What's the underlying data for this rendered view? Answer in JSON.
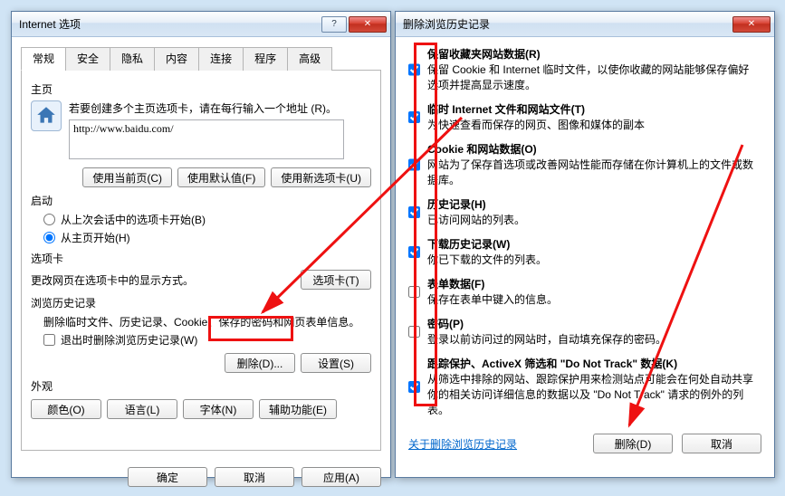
{
  "left": {
    "title": "Internet 选项",
    "tabs": [
      "常规",
      "安全",
      "隐私",
      "内容",
      "连接",
      "程序",
      "高级"
    ],
    "active_tab": 0,
    "home": {
      "label": "主页",
      "desc": "若要创建多个主页选项卡，请在每行输入一个地址 (R)。",
      "url_value": "http://www.baidu.com/",
      "btn_current": "使用当前页(C)",
      "btn_default": "使用默认值(F)",
      "btn_newtab": "使用新选项卡(U)"
    },
    "startup": {
      "label": "启动",
      "opt_last": "从上次会话中的选项卡开始(B)",
      "opt_home": "从主页开始(H)",
      "selected": "home"
    },
    "tabs_section": {
      "label": "选项卡",
      "desc": "更改网页在选项卡中的显示方式。",
      "btn": "选项卡(T)"
    },
    "history": {
      "label": "浏览历史记录",
      "desc": "删除临时文件、历史记录、Cookie、保存的密码和网页表单信息。",
      "chk_exit": "退出时删除浏览历史记录(W)",
      "btn_delete": "删除(D)...",
      "btn_settings": "设置(S)"
    },
    "appearance": {
      "label": "外观",
      "btn_color": "颜色(O)",
      "btn_lang": "语言(L)",
      "btn_font": "字体(N)",
      "btn_access": "辅助功能(E)"
    },
    "footer": {
      "ok": "确定",
      "cancel": "取消",
      "apply": "应用(A)"
    }
  },
  "right": {
    "title": "删除浏览历史记录",
    "items": [
      {
        "checked": true,
        "title": "保留收藏夹网站数据(R)",
        "desc": "保留 Cookie 和 Internet 临时文件，以使你收藏的网站能够保存偏好选项并提高显示速度。"
      },
      {
        "checked": true,
        "title": "临时 Internet 文件和网站文件(T)",
        "desc": "为快速查看而保存的网页、图像和媒体的副本"
      },
      {
        "checked": true,
        "title": "Cookie 和网站数据(O)",
        "desc": "网站为了保存首选项或改善网站性能而存储在你计算机上的文件或数据库。"
      },
      {
        "checked": true,
        "title": "历史记录(H)",
        "desc": "已访问网站的列表。"
      },
      {
        "checked": true,
        "title": "下载历史记录(W)",
        "desc": "你已下载的文件的列表。"
      },
      {
        "checked": false,
        "title": "表单数据(F)",
        "desc": "保存在表单中键入的信息。"
      },
      {
        "checked": false,
        "title": "密码(P)",
        "desc": "登录以前访问过的网站时，自动填充保存的密码。"
      },
      {
        "checked": true,
        "title": "跟踪保护、ActiveX 筛选和 \"Do Not Track\" 数据(K)",
        "desc": "从筛选中排除的网站、跟踪保护用来检测站点可能会在何处自动共享你的相关访问详细信息的数据以及 \"Do Not Track\" 请求的例外的列表。"
      }
    ],
    "link": "关于删除浏览历史记录",
    "btn_delete": "删除(D)",
    "btn_cancel": "取消"
  }
}
